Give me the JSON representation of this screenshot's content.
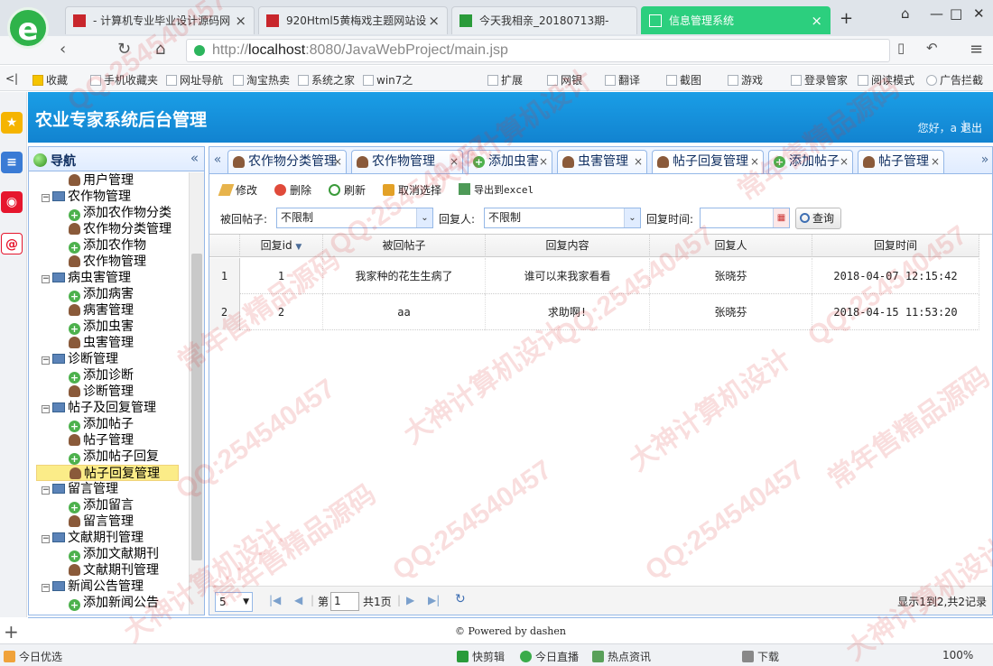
{
  "browser": {
    "tabs": [
      {
        "title": "- 计算机专业毕业设计源码网",
        "active": false
      },
      {
        "title": "920Html5黄梅戏主题网站设",
        "active": false
      },
      {
        "title": "今天我相亲_20180713期-",
        "active": false
      },
      {
        "title": "信息管理系统",
        "active": true
      }
    ],
    "new_tab": "+",
    "url_prefix": "http://",
    "url_host": "localhost",
    "url_path": ":8080/JavaWebProject/main.jsp",
    "bookmarks": [
      "收藏",
      "手机收藏夹",
      "网址导航",
      "淘宝热卖",
      "系统之家",
      "win7之",
      "扩展",
      "网银",
      "翻译",
      "截图",
      "游戏",
      "登录管家",
      "阅读模式",
      "广告拦截"
    ]
  },
  "header": {
    "title": "农业专家系统后台管理",
    "greeting": "您好，a",
    "separator": "|",
    "logout": "退出"
  },
  "nav": {
    "title": "导航",
    "collapse": "«",
    "tree": [
      {
        "label": "用户管理",
        "level": 2,
        "icon": "user"
      },
      {
        "label": "农作物管理",
        "level": 1,
        "icon": "folder"
      },
      {
        "label": "添加农作物分类",
        "level": 2,
        "icon": "add"
      },
      {
        "label": "农作物分类管理",
        "level": 2,
        "icon": "user"
      },
      {
        "label": "添加农作物",
        "level": 2,
        "icon": "add"
      },
      {
        "label": "农作物管理",
        "level": 2,
        "icon": "user"
      },
      {
        "label": "病虫害管理",
        "level": 1,
        "icon": "folder"
      },
      {
        "label": "添加病害",
        "level": 2,
        "icon": "add"
      },
      {
        "label": "病害管理",
        "level": 2,
        "icon": "user"
      },
      {
        "label": "添加虫害",
        "level": 2,
        "icon": "add"
      },
      {
        "label": "虫害管理",
        "level": 2,
        "icon": "user"
      },
      {
        "label": "诊断管理",
        "level": 1,
        "icon": "folder"
      },
      {
        "label": "添加诊断",
        "level": 2,
        "icon": "add"
      },
      {
        "label": "诊断管理",
        "level": 2,
        "icon": "user"
      },
      {
        "label": "帖子及回复管理",
        "level": 1,
        "icon": "folder"
      },
      {
        "label": "添加帖子",
        "level": 2,
        "icon": "add"
      },
      {
        "label": "帖子管理",
        "level": 2,
        "icon": "user"
      },
      {
        "label": "添加帖子回复",
        "level": 2,
        "icon": "add"
      },
      {
        "label": "帖子回复管理",
        "level": 2,
        "icon": "user",
        "selected": true
      },
      {
        "label": "留言管理",
        "level": 1,
        "icon": "folder"
      },
      {
        "label": "添加留言",
        "level": 2,
        "icon": "add"
      },
      {
        "label": "留言管理",
        "level": 2,
        "icon": "user"
      },
      {
        "label": "文献期刊管理",
        "level": 1,
        "icon": "folder"
      },
      {
        "label": "添加文献期刊",
        "level": 2,
        "icon": "add"
      },
      {
        "label": "文献期刊管理",
        "level": 2,
        "icon": "user"
      },
      {
        "label": "新闻公告管理",
        "level": 1,
        "icon": "folder"
      },
      {
        "label": "添加新闻公告",
        "level": 2,
        "icon": "add"
      }
    ]
  },
  "main": {
    "tabs": [
      {
        "label": "农作物分类管理",
        "icon": "user"
      },
      {
        "label": "农作物管理",
        "icon": "user"
      },
      {
        "label": "添加虫害",
        "icon": "add"
      },
      {
        "label": "虫害管理",
        "icon": "user"
      },
      {
        "label": "帖子回复管理",
        "icon": "user",
        "active": true
      },
      {
        "label": "添加帖子",
        "icon": "add"
      },
      {
        "label": "帖子管理",
        "icon": "user"
      }
    ],
    "toolbar": {
      "edit": "修改",
      "delete": "删除",
      "refresh": "刷新",
      "cancel_select": "取消选择",
      "export": "导出到excel"
    },
    "filters": {
      "post_label": "被回帖子:",
      "post_value": "不限制",
      "replier_label": "回复人:",
      "replier_value": "不限制",
      "time_label": "回复时间:",
      "time_value": "",
      "query": "查询"
    },
    "grid": {
      "headers": [
        "回复id",
        "被回帖子",
        "回复内容",
        "回复人",
        "回复时间"
      ],
      "rows": [
        {
          "num": "1",
          "id": "1",
          "post": "我家种的花生生病了",
          "content": "谁可以来我家看看",
          "replier": "张晓芬",
          "time": "2018-04-07 12:15:42"
        },
        {
          "num": "2",
          "id": "2",
          "post": "aa",
          "content": "求助啊!",
          "replier": "张晓芬",
          "time": "2018-04-15 11:53:20"
        }
      ]
    },
    "pager": {
      "page_size": "5",
      "page_prefix": "第",
      "page": "1",
      "page_suffix": "共1页",
      "summary": "显示1到2,共2记录"
    }
  },
  "footer": {
    "text": "© Powered by dashen"
  },
  "statusbar": {
    "items": [
      "今日优选",
      "快剪辑",
      "今日直播",
      "热点资讯",
      "下载",
      "100%"
    ]
  },
  "watermark": {
    "qq": "QQ:254540457",
    "line1": "常年售精品源码",
    "line2": "大神计算机设计"
  }
}
